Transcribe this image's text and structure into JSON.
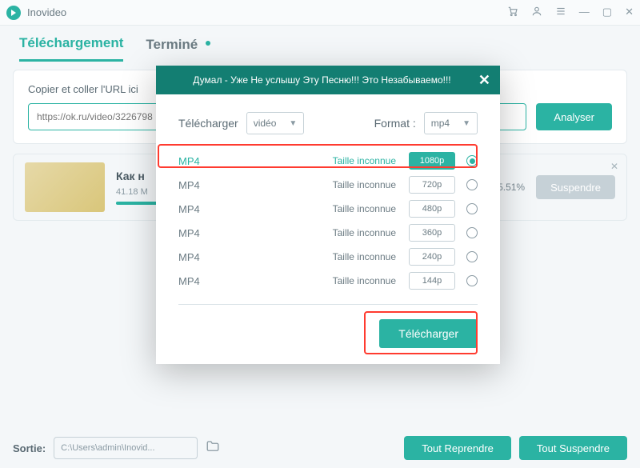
{
  "app": {
    "name": "Inovideo"
  },
  "tabs": {
    "download": "Téléchargement",
    "done": "Terminé"
  },
  "paste": {
    "title": "Copier et coller l'URL ici",
    "placeholder": "https://ok.ru/video/3226798",
    "analyze": "Analyser"
  },
  "item": {
    "title": "Как н",
    "meta": "41.18 M",
    "progress_pct": 55.51,
    "pct_text": "5.51%",
    "suspend": "Suspendre"
  },
  "footer": {
    "label": "Sortie:",
    "path": "C:\\Users\\admin\\Inovid...",
    "resume_all": "Tout Reprendre",
    "suspend_all": "Tout Suspendre"
  },
  "modal": {
    "title": "Думал - Уже Не услышу Эту Песню!!! Это Незабываемо!!!",
    "download_label": "Télécharger",
    "download_select": "vidéo",
    "format_label": "Format :",
    "format_select": "mp4",
    "size_unknown": "Taille inconnue",
    "download_btn": "Télécharger",
    "rows": [
      {
        "fmt": "MP4",
        "res": "1080p",
        "selected": true
      },
      {
        "fmt": "MP4",
        "res": "720p",
        "selected": false
      },
      {
        "fmt": "MP4",
        "res": "480p",
        "selected": false
      },
      {
        "fmt": "MP4",
        "res": "360p",
        "selected": false
      },
      {
        "fmt": "MP4",
        "res": "240p",
        "selected": false
      },
      {
        "fmt": "MP4",
        "res": "144p",
        "selected": false
      }
    ]
  }
}
